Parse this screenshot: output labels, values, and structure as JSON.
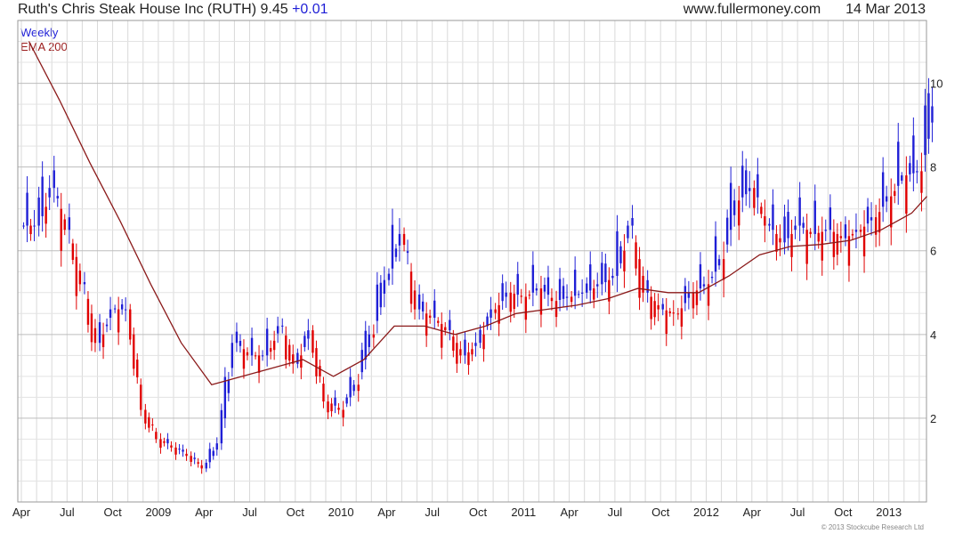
{
  "header": {
    "title": "Ruth's Chris Steak House Inc (RUTH)",
    "price": "9.45",
    "change": "+0.01",
    "source": "www.fullermoney.com",
    "date": "14 Mar 2013"
  },
  "legend": {
    "weekly": "Weekly",
    "ema": "EMA 200"
  },
  "footer": "© 2013 Stockcube Research Ltd",
  "colors": {
    "up": "#1f1fd6",
    "down": "#e00000",
    "ema": "#8b1a1a",
    "grid": "#d9d9d9"
  },
  "chart_data": {
    "type": "line",
    "title": "Ruth's Chris Steak House Inc (RUTH) 9.45 +0.01",
    "grid": true,
    "ylim": [
      0,
      11.5
    ],
    "x_ticks": [
      "Apr",
      "Jul",
      "Oct",
      "2009",
      "Apr",
      "Jul",
      "Oct",
      "2010",
      "Apr",
      "Jul",
      "Oct",
      "2011",
      "Apr",
      "Jul",
      "Oct",
      "2012",
      "Apr",
      "Jul",
      "Oct",
      "2013"
    ],
    "x_range": [
      "2008-04",
      "2013-03"
    ],
    "y_ticks": [
      2,
      4,
      6,
      8,
      10
    ],
    "series": [
      {
        "name": "Weekly",
        "style": "candlestick",
        "x": [
          "2008-04",
          "2008-05",
          "2008-06",
          "2008-07",
          "2008-08",
          "2008-09",
          "2008-10",
          "2008-11",
          "2008-12",
          "2009-01",
          "2009-02",
          "2009-03",
          "2009-04",
          "2009-05",
          "2009-06",
          "2009-07",
          "2009-08",
          "2009-09",
          "2009-10",
          "2009-11",
          "2009-12",
          "2010-01",
          "2010-02",
          "2010-03",
          "2010-04",
          "2010-05",
          "2010-06",
          "2010-07",
          "2010-08",
          "2010-09",
          "2010-10",
          "2010-11",
          "2010-12",
          "2011-01",
          "2011-02",
          "2011-03",
          "2011-04",
          "2011-05",
          "2011-06",
          "2011-07",
          "2011-08",
          "2011-09",
          "2011-10",
          "2011-11",
          "2011-12",
          "2012-01",
          "2012-02",
          "2012-03",
          "2012-04",
          "2012-05",
          "2012-06",
          "2012-07",
          "2012-08",
          "2012-09",
          "2012-10",
          "2012-11",
          "2012-12",
          "2013-01",
          "2013-02",
          "2013-03"
        ],
        "values": [
          6.6,
          7.5,
          6.5,
          5.2,
          3.8,
          4.6,
          4.6,
          2.2,
          1.5,
          1.3,
          1.1,
          0.8,
          1.4,
          3.8,
          3.5,
          3.5,
          4.2,
          3.3,
          4.1,
          2.4,
          2.2,
          2.8,
          4.0,
          5.3,
          6.4,
          4.6,
          4.4,
          4.1,
          3.5,
          3.8,
          4.6,
          5.0,
          4.9,
          5.1,
          4.8,
          4.9,
          5.0,
          5.2,
          5.4,
          6.6,
          5.0,
          4.6,
          4.5,
          5.0,
          5.2,
          5.8,
          7.2,
          7.5,
          6.6,
          6.2,
          6.6,
          6.4,
          6.5,
          6.3,
          6.5,
          6.8,
          7.3,
          7.8,
          7.9,
          9.45
        ]
      },
      {
        "name": "EMA 200",
        "style": "line",
        "x": [
          "2008-04",
          "2008-06",
          "2008-08",
          "2008-10",
          "2008-12",
          "2009-02",
          "2009-04",
          "2009-06",
          "2009-08",
          "2009-10",
          "2009-12",
          "2010-02",
          "2010-04",
          "2010-06",
          "2010-08",
          "2010-10",
          "2010-12",
          "2011-02",
          "2011-04",
          "2011-06",
          "2011-08",
          "2011-10",
          "2011-12",
          "2012-02",
          "2012-04",
          "2012-06",
          "2012-08",
          "2012-10",
          "2012-12",
          "2013-02",
          "2013-03"
        ],
        "values": [
          11.0,
          9.6,
          8.1,
          6.7,
          5.2,
          3.8,
          2.8,
          3.0,
          3.2,
          3.4,
          3.0,
          3.4,
          4.2,
          4.2,
          4.0,
          4.2,
          4.5,
          4.6,
          4.7,
          4.85,
          5.1,
          5.0,
          5.0,
          5.4,
          5.9,
          6.1,
          6.15,
          6.25,
          6.5,
          6.9,
          7.3
        ]
      }
    ]
  }
}
